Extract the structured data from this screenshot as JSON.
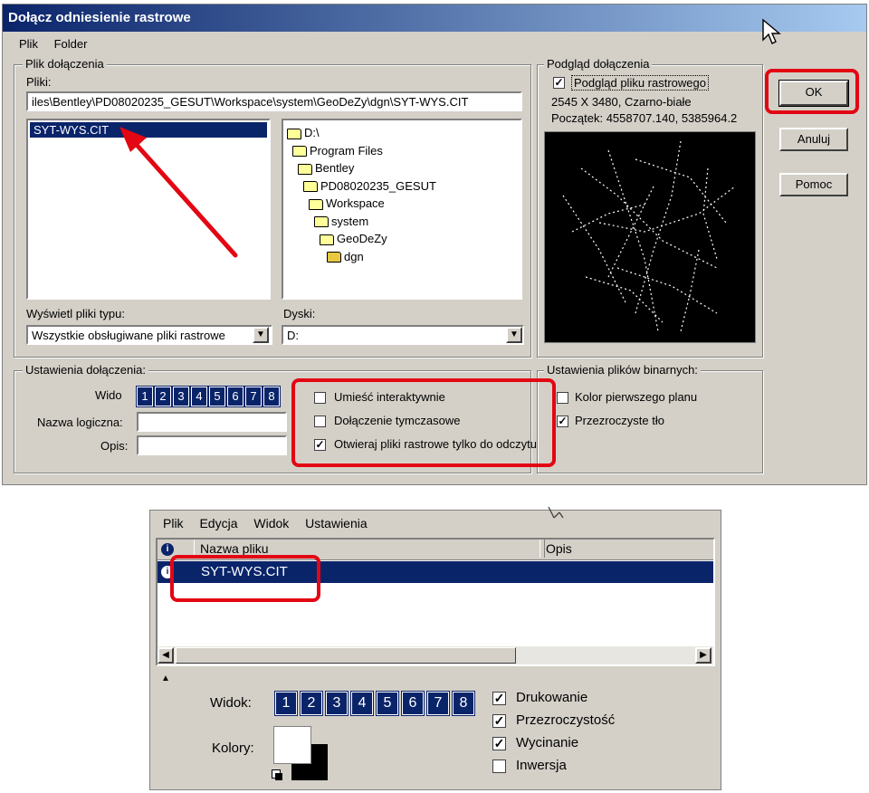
{
  "dialog": {
    "title": "Dołącz odniesienie rastrowe",
    "menu": [
      "Plik",
      "Folder"
    ],
    "file_group_label": "Plik dołączenia",
    "files_label": "Pliki:",
    "path_value": "iles\\Bentley\\PD08020235_GESUT\\Workspace\\system\\GeoDeZy\\dgn\\SYT-WYS.CIT",
    "file_list": [
      "SYT-WYS.CIT"
    ],
    "folders": [
      "D:\\",
      "Program Files",
      "Bentley",
      "PD08020235_GESUT",
      "Workspace",
      "system",
      "GeoDeZy",
      "dgn"
    ],
    "filetype_label": "Wyświetl pliki typu:",
    "filetype_value": "Wszystkie obsługiwane pliki rastrowe",
    "drives_label": "Dyski:",
    "drives_value": "D:",
    "preview_group_label": "Podgląd dołączenia",
    "preview_checkbox_label": "Podgląd pliku rastrowego",
    "preview_info_1": "2545 X 3480, Czarno-białe",
    "preview_info_2": "Początek: 4558707.140, 5385964.2",
    "buttons": {
      "ok": "OK",
      "cancel": "Anuluj",
      "help": "Pomoc"
    },
    "settings_group_label": "Ustawienia dołączenia:",
    "view_label": "Wido",
    "views": [
      "1",
      "2",
      "3",
      "4",
      "5",
      "6",
      "7",
      "8"
    ],
    "logical_name_label": "Nazwa logiczna:",
    "logical_name_value": "",
    "description_label": "Opis:",
    "description_value": "",
    "options": [
      {
        "label": "Umieść interaktywnie",
        "checked": false
      },
      {
        "label": "Dołączenie tymczasowe",
        "checked": false
      },
      {
        "label": "Otwieraj pliki rastrowe tylko do odczytu",
        "checked": true
      }
    ],
    "binary_group_label": "Ustawienia plików binarnych:",
    "binary_options": [
      {
        "label": "Kolor pierwszego planu",
        "checked": false
      },
      {
        "label": "Przezroczyste tło",
        "checked": true
      }
    ]
  },
  "manager": {
    "menu": [
      "Plik",
      "Edycja",
      "Widok",
      "Ustawienia"
    ],
    "columns": [
      "Nazwa pliku",
      "Opis"
    ],
    "rows": [
      {
        "name": "SYT-WYS.CIT",
        "description": ""
      }
    ],
    "view_label": "Widok:",
    "views": [
      "1",
      "2",
      "3",
      "4",
      "5",
      "6",
      "7",
      "8"
    ],
    "colors_label": "Kolory:",
    "options": [
      {
        "label": "Drukowanie",
        "checked": true
      },
      {
        "label": "Przezroczystość",
        "checked": true
      },
      {
        "label": "Wycinanie",
        "checked": true
      },
      {
        "label": "Inwersja",
        "checked": false
      }
    ]
  },
  "colors": {
    "titlebar": "#0a246a",
    "selection": "#0a246a",
    "annotation": "#e30613",
    "face": "#d4d0c8"
  }
}
